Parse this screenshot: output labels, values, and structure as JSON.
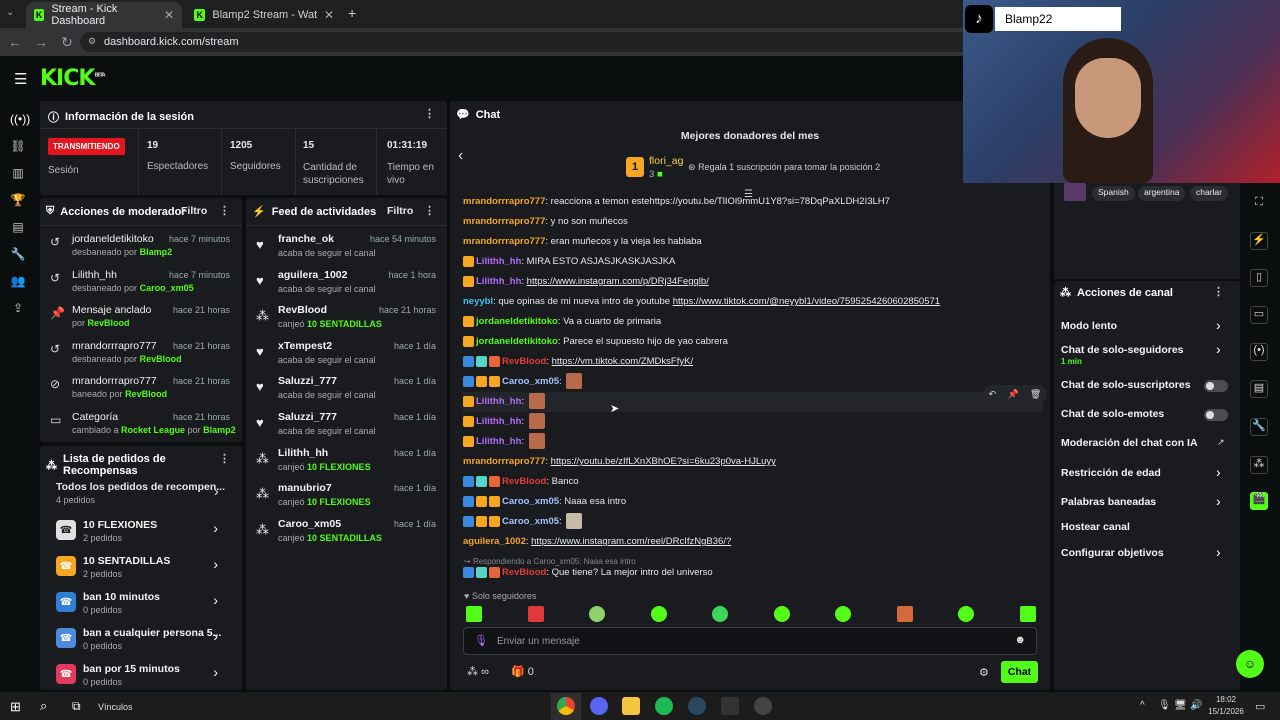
{
  "browser": {
    "tabs": [
      {
        "title": "Stream - Kick Dashboard",
        "active": true
      },
      {
        "title": "Blamp2 Stream - Watch Live on",
        "active": false
      }
    ],
    "new_tab": "+",
    "url": "dashboard.kick.com/stream"
  },
  "logo": "KICK",
  "logo_sup": "BETA",
  "session": {
    "title": "Información de la sesión",
    "live_badge": "TRANSMITIENDO",
    "session_label": "Sesión",
    "stats": [
      {
        "value": "19",
        "label": "Espectadores"
      },
      {
        "value": "1205",
        "label": "Seguidores"
      },
      {
        "value": "15",
        "label": "Cantidad de suscripciones"
      },
      {
        "value": "01:31:19",
        "label": "Tiempo en vivo"
      }
    ]
  },
  "moderator": {
    "title": "Acciones de moderador",
    "filter": "Filtro",
    "rows": [
      {
        "name": "jordaneldetikitoko",
        "time": "hace 7 minutos",
        "sub": "desbaneado por",
        "by": "Blamp2",
        "icon": "↺"
      },
      {
        "name": "Lilithh_hh",
        "time": "hace 7 minutos",
        "sub": "desbaneado por",
        "by": "Caroo_xm05",
        "icon": "↺"
      },
      {
        "name": "Mensaje anclado",
        "time": "hace 21 horas",
        "sub": "por",
        "by": "RevBlood",
        "icon": "📌"
      },
      {
        "name": "mrandorrrapro777",
        "time": "hace 21 horas",
        "sub": "desbaneado por",
        "by": "RevBlood",
        "icon": "↺"
      },
      {
        "name": "mrandorrrapro777",
        "time": "hace 21 horas",
        "sub": "baneado por",
        "by": "RevBlood",
        "icon": "⊘"
      },
      {
        "name": "Categoría",
        "time": "hace 21 horas",
        "sub": "cambiado a",
        "by": "Rocket League",
        "sub2": "por",
        "by2": "Blamp2",
        "icon": "▭"
      }
    ]
  },
  "activity": {
    "title": "Feed de actividades",
    "filter": "Filtro",
    "rows": [
      {
        "name": "franche_ok",
        "time": "hace 54 minutos",
        "sub": "acaba de seguir el canal",
        "extra": "",
        "icon": "♥"
      },
      {
        "name": "aguilera_1002",
        "time": "hace 1 hora",
        "sub": "acaba de seguir el canal",
        "extra": "",
        "icon": "♥"
      },
      {
        "name": "RevBlood",
        "time": "hace 21 horas",
        "sub": "canjeó",
        "extra": "10 SENTADILLAS",
        "icon": "●"
      },
      {
        "name": "xTempest2",
        "time": "hace 1 día",
        "sub": "acaba de seguir el canal",
        "extra": "",
        "icon": "♥"
      },
      {
        "name": "Saluzzi_777",
        "time": "hace 1 día",
        "sub": "acaba de seguir el canal",
        "extra": "",
        "icon": "♥"
      },
      {
        "name": "Saluzzi_777",
        "time": "hace 1 día",
        "sub": "acaba de seguir el canal",
        "extra": "",
        "icon": "♥"
      },
      {
        "name": "Lilithh_hh",
        "time": "hace 1 día",
        "sub": "canjeó",
        "extra": "10 FLEXIONES",
        "icon": "●"
      },
      {
        "name": "manubrio7",
        "time": "hace 1 día",
        "sub": "canjeó",
        "extra": "10 FLEXIONES",
        "icon": "●"
      },
      {
        "name": "Caroo_xm05",
        "time": "hace 1 día",
        "sub": "canjeó",
        "extra": "10 SENTADILLAS",
        "icon": "●"
      }
    ]
  },
  "rewards": {
    "title": "Lista de pedidos de Recompensas",
    "all_label": "Todos los pedidos de recompen...",
    "all_count": "4 pedidos",
    "rows": [
      {
        "name": "10 FLEXIONES",
        "count": "2 pedidos",
        "color": "#e0e0e0"
      },
      {
        "name": "10 SENTADILLAS",
        "count": "2 pedidos",
        "color": "#f6a623"
      },
      {
        "name": "ban 10 minutos",
        "count": "0 pedidos",
        "color": "#2f7fd6"
      },
      {
        "name": "ban a cualquier persona 5...",
        "count": "0 pedidos",
        "color": "#4a8be0"
      },
      {
        "name": "ban por 15 minutos",
        "count": "0 pedidos",
        "color": "#e23a5a"
      }
    ]
  },
  "chat": {
    "title": "Chat",
    "donors_title": "Mejores donadores del mes",
    "donor_rank": "1",
    "donor_name": "flori_ag",
    "donor_count": "3",
    "gift_text": "Regala 1 suscripción para tomar la posición 2",
    "messages": [
      {
        "user": "mrandorrrapro777",
        "color": "#f6a623",
        "text": ": reacciona a temon estehttps://youtu.be/TlIOl9mmU1Y8?si=78DqPaXLDH2I3LH7",
        "link": false
      },
      {
        "user": "mrandorrrapro777",
        "color": "#f6a623",
        "text": ": y no son muñecos",
        "link": false
      },
      {
        "user": "mrandorrrapro777",
        "color": "#f6a623",
        "text": ": eran muñecos y la vieja les hablaba",
        "link": false
      },
      {
        "user": "Lilithh_hh",
        "color": "#b46cf5",
        "text": ": MIRA ESTO ASJASJKASKJASJKA",
        "link": false
      },
      {
        "user": "Lilithh_hh",
        "color": "#b46cf5",
        "text": ": ",
        "link": "https://www.instagram.com/p/DRj34Fegqlb/"
      },
      {
        "user": "neyybl",
        "color": "#3fc0f0",
        "text": ": que opinas de mi nueva intro de youtube ",
        "link": "https://www.tiktok.com/@neyybl1/video/7595254260602850571"
      },
      {
        "user": "jordaneldetikitoko",
        "color": "#53fc18",
        "text": ": Va a cuarto de primaria",
        "link": false
      },
      {
        "user": "jordaneldetikitoko",
        "color": "#53fc18",
        "text": ": Parece el supuesto hijo de yao cabrera",
        "link": false
      },
      {
        "user": "RevBlood",
        "color": "#e23a3a",
        "text": ": ",
        "link": "https://vm.tiktok.com/ZMDksFfyK/"
      },
      {
        "user": "Caroo_xm05",
        "color": "#a0c4ff",
        "text": ": ",
        "link": false
      },
      {
        "user": "Lilithh_hh",
        "color": "#b46cf5",
        "text": ": ",
        "link": false
      },
      {
        "user": "Lilithh_hh",
        "color": "#b46cf5",
        "text": ": ",
        "link": false
      },
      {
        "user": "Lilithh_hh",
        "color": "#b46cf5",
        "text": ": ",
        "link": false
      },
      {
        "user": "mrandorrrapro777",
        "color": "#f6a623",
        "text": ": ",
        "link": "https://youtu.be/zIfLXnXBhOE?si=6ku23p0va-HJLuyy"
      },
      {
        "user": "RevBlood",
        "color": "#e23a3a",
        "text": ": Banco",
        "link": false
      },
      {
        "user": "Caroo_xm05",
        "color": "#a0c4ff",
        "text": ": Naaa esa intro",
        "link": false
      },
      {
        "user": "Caroo_xm05",
        "color": "#a0c4ff",
        "text": ": ",
        "link": false
      },
      {
        "user": "aguilera_1002",
        "color": "#f6a623",
        "text": ": ",
        "link": "https://www.instagram.com/reel/DRcIfzNgB36/?"
      },
      {
        "user": "RevBlood",
        "color": "#e23a3a",
        "text": ": Que tiene? La mejor intro del universo",
        "link": false
      }
    ],
    "reply_to": "Respondiendo a Caroo_xm05: Naaa esa intro",
    "followers_only": "Solo seguidores",
    "placeholder": "Enviar un mensaje",
    "infinity": "∞",
    "gift_count": "0",
    "send": "Chat"
  },
  "channel_actions": {
    "title": "Acciones de canal",
    "tags": [
      "Spanish",
      "argentina",
      "charlar"
    ],
    "items": [
      {
        "label": "Modo lento",
        "sub": "",
        "kind": "chevron"
      },
      {
        "label": "Chat de solo-seguidores",
        "sub": "1 min",
        "kind": "chevron"
      },
      {
        "label": "Chat de solo-suscriptores",
        "sub": "",
        "kind": "toggle"
      },
      {
        "label": "Chat de solo-emotes",
        "sub": "",
        "kind": "toggle"
      },
      {
        "label": "Moderación del chat con IA",
        "sub": "",
        "kind": "ext"
      },
      {
        "label": "Restricción de edad",
        "sub": "",
        "kind": "chevron"
      },
      {
        "label": "Palabras baneadas",
        "sub": "",
        "kind": "chevron"
      },
      {
        "label": "Hostear canal",
        "sub": "",
        "kind": "none"
      },
      {
        "label": "Configurar objetivos",
        "sub": "",
        "kind": "chevron"
      }
    ]
  },
  "webcam": {
    "tiktok_name": "Blamp22"
  },
  "taskbar": {
    "links": "Vínculos",
    "time": "18:02",
    "date": "15/1/2026"
  }
}
